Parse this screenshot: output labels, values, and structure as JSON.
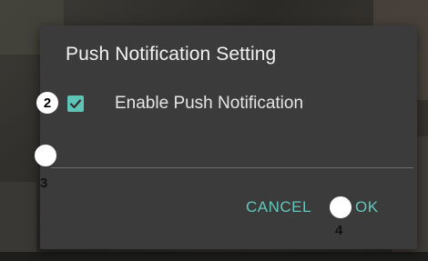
{
  "dialog": {
    "title": "Push Notification Setting",
    "checkbox_label": "Enable Push Notification",
    "checkbox_checked": true,
    "cancel_label": "CANCEL",
    "ok_label": "OK"
  },
  "annotations": {
    "marker_2": "2",
    "marker_3": "3",
    "marker_4": "4"
  },
  "colors": {
    "accent": "#5ec4b6",
    "dialog_bg": "#3b3b3b",
    "title_text": "#f2f2f2"
  }
}
